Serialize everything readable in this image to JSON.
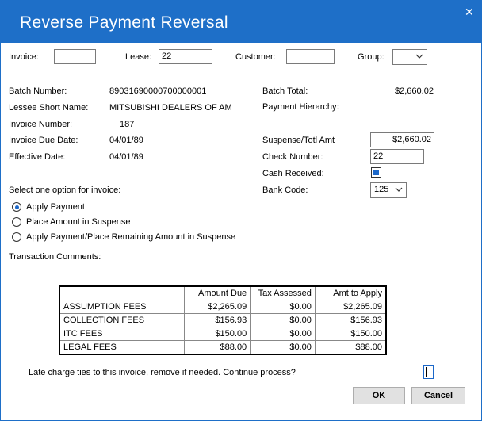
{
  "window": {
    "title": "Reverse Payment Reversal",
    "minimize_glyph": "—",
    "close_glyph": "✕"
  },
  "top_fields": {
    "invoice_label": "Invoice:",
    "invoice_value": "",
    "lease_label": "Lease:",
    "lease_value": "22",
    "customer_label": "Customer:",
    "customer_value": "",
    "group_label": "Group:",
    "group_value": ""
  },
  "details": {
    "batch_number_label": "Batch Number:",
    "batch_number_value": "89031690000700000001",
    "lessee_label": "Lessee Short Name:",
    "lessee_value": "MITSUBISHI DEALERS OF AM",
    "invoice_number_label": "Invoice Number:",
    "invoice_number_value": "187",
    "invoice_due_label": "Invoice Due Date:",
    "invoice_due_value": "04/01/89",
    "effective_label": "Effective Date:",
    "effective_value": "04/01/89"
  },
  "right_details": {
    "batch_total_label": "Batch Total:",
    "batch_total_value": "$2,660.02",
    "payment_hierarchy_label": "Payment Hierarchy:",
    "suspense_label": "Suspense/Totl Amt",
    "suspense_value": "$2,660.02",
    "check_number_label": "Check Number:",
    "check_number_value": "22",
    "cash_received_label": "Cash Received:",
    "cash_received_checked": true,
    "bank_code_label": "Bank Code:",
    "bank_code_value": "125"
  },
  "options": {
    "prompt": "Select one option for invoice:",
    "items": [
      {
        "label": "Apply Payment",
        "selected": true
      },
      {
        "label": "Place Amount in Suspense",
        "selected": false
      },
      {
        "label": "Apply Payment/Place Remaining Amount in Suspense",
        "selected": false
      }
    ]
  },
  "comments_label": "Transaction Comments:",
  "fees_table": {
    "headers": [
      "",
      "Amount Due",
      "Tax Assessed",
      "Amt to Apply"
    ],
    "rows": [
      [
        "ASSUMPTION FEES",
        "$2,265.09",
        "$0.00",
        "$2,265.09"
      ],
      [
        "COLLECTION FEES",
        "$156.93",
        "$0.00",
        "$156.93"
      ],
      [
        "ITC FEES",
        "$150.00",
        "$0.00",
        "$150.00"
      ],
      [
        "LEGAL FEES",
        "$88.00",
        "$0.00",
        "$88.00"
      ]
    ]
  },
  "footer": {
    "message": "Late charge ties to this invoice, remove if needed. Continue process?",
    "ok_label": "OK",
    "cancel_label": "Cancel"
  },
  "colors": {
    "titlebar": "#1e6fc8",
    "accent": "#1c68c9"
  }
}
